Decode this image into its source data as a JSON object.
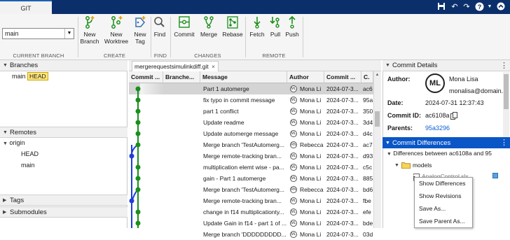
{
  "titlebar": {
    "tab": "GIT"
  },
  "toolstrip": {
    "branch_value": "main",
    "current_branch_label": "CURRENT BRANCH",
    "create_label": "CREATE",
    "find_label": "FIND",
    "changes_label": "CHANGES",
    "remote_label": "REMOTE",
    "new_branch": [
      "New",
      "Branch"
    ],
    "new_worktree": [
      "New",
      "Worktree"
    ],
    "new_tag": [
      "New",
      "Tag"
    ],
    "find": "Find",
    "commit": "Commit",
    "merge": "Merge",
    "rebase": "Rebase",
    "fetch": "Fetch",
    "pull": "Pull",
    "push": "Push"
  },
  "branches": {
    "title": "Branches",
    "item": "main",
    "head_badge": "HEAD"
  },
  "remotes": {
    "title": "Remotes",
    "origin": "origin",
    "head": "HEAD",
    "main": "main"
  },
  "tags": {
    "title": "Tags"
  },
  "submodules": {
    "title": "Submodules"
  },
  "repo_tab": {
    "name": "mergerequestsimulinkdiff.git",
    "close": "×"
  },
  "table": {
    "columns": [
      "Commit ...",
      "Branche...",
      "Message",
      "Author",
      "Commit ...",
      "C."
    ],
    "rows": [
      {
        "message": "Part 1 automerge",
        "initials": "ML",
        "author": "Mona Li",
        "date": "2024-07-3...",
        "id": "ac6"
      },
      {
        "message": "fix typo in commit message",
        "initials": "ML",
        "author": "Mona Li",
        "date": "2024-07-3...",
        "id": "95a"
      },
      {
        "message": "part 1 conflict",
        "initials": "ML",
        "author": "Mona Li",
        "date": "2024-07-3...",
        "id": "350"
      },
      {
        "message": "Update readme",
        "initials": "ML",
        "author": "Mona Li",
        "date": "2024-07-3...",
        "id": "3d4"
      },
      {
        "message": "Update automerge message",
        "initials": "ML",
        "author": "Mona Li",
        "date": "2024-07-3...",
        "id": "d4c"
      },
      {
        "message": "Merge branch 'TestAutomerg...",
        "initials": "RN",
        "author": "Rebecca",
        "date": "2024-07-3...",
        "id": "ac7"
      },
      {
        "message": "Merge remote-tracking bran...",
        "initials": "ML",
        "author": "Mona Li",
        "date": "2024-07-3...",
        "id": "d93"
      },
      {
        "message": "multiplication elemt wise - pa...",
        "initials": "ML",
        "author": "Mona Li",
        "date": "2024-07-3...",
        "id": "c5c"
      },
      {
        "message": "gain - Part 1 automerge",
        "initials": "ML",
        "author": "Mona Li",
        "date": "2024-07-3...",
        "id": "885"
      },
      {
        "message": "Merge branch 'TestAutomerg...",
        "initials": "RN",
        "author": "Rebecca",
        "date": "2024-07-3...",
        "id": "bd6"
      },
      {
        "message": "Merge remote-tracking bran...",
        "initials": "ML",
        "author": "Mona Li",
        "date": "2024-07-3...",
        "id": "fbe"
      },
      {
        "message": "change in f14 multiplicationty...",
        "initials": "ML",
        "author": "Mona Li",
        "date": "2024-07-3...",
        "id": "efe"
      },
      {
        "message": "Update Gain in f14 - part 1 of ...",
        "initials": "ML",
        "author": "Mona Li",
        "date": "2024-07-3...",
        "id": "bde"
      },
      {
        "message": "Merge branch 'DDDDDDDDD...",
        "initials": "ML",
        "author": "Mona Li",
        "date": "2024-07-3...",
        "id": "03d"
      }
    ]
  },
  "commit_details": {
    "title": "Commit Details",
    "author_label": "Author:",
    "author_name": "Mona Lisa",
    "author_email": "monalisa@domain.co",
    "avatar_initials": "ML",
    "date_label": "Date:",
    "date_value": "2024-07-31 12:37:43",
    "commit_id_label": "Commit ID:",
    "commit_id_value": "ac6108a",
    "parents_label": "Parents:",
    "parents_value": "95a3296"
  },
  "commit_differences": {
    "title": "Commit Differences",
    "summary": "Differences between ac6108a and 95",
    "folder": "models",
    "file": "AnalogControl.slx"
  },
  "context_menu": {
    "items": [
      "Show Differences",
      "Show Revisions",
      "Save As...",
      "Save Parent As..."
    ]
  },
  "colors": {
    "titlebar": "#0b2f6b",
    "selection": "#0a56c7",
    "graph_green": "#1a8f1a",
    "graph_blue": "#1f3fd6",
    "head_badge": "#ffe680"
  }
}
